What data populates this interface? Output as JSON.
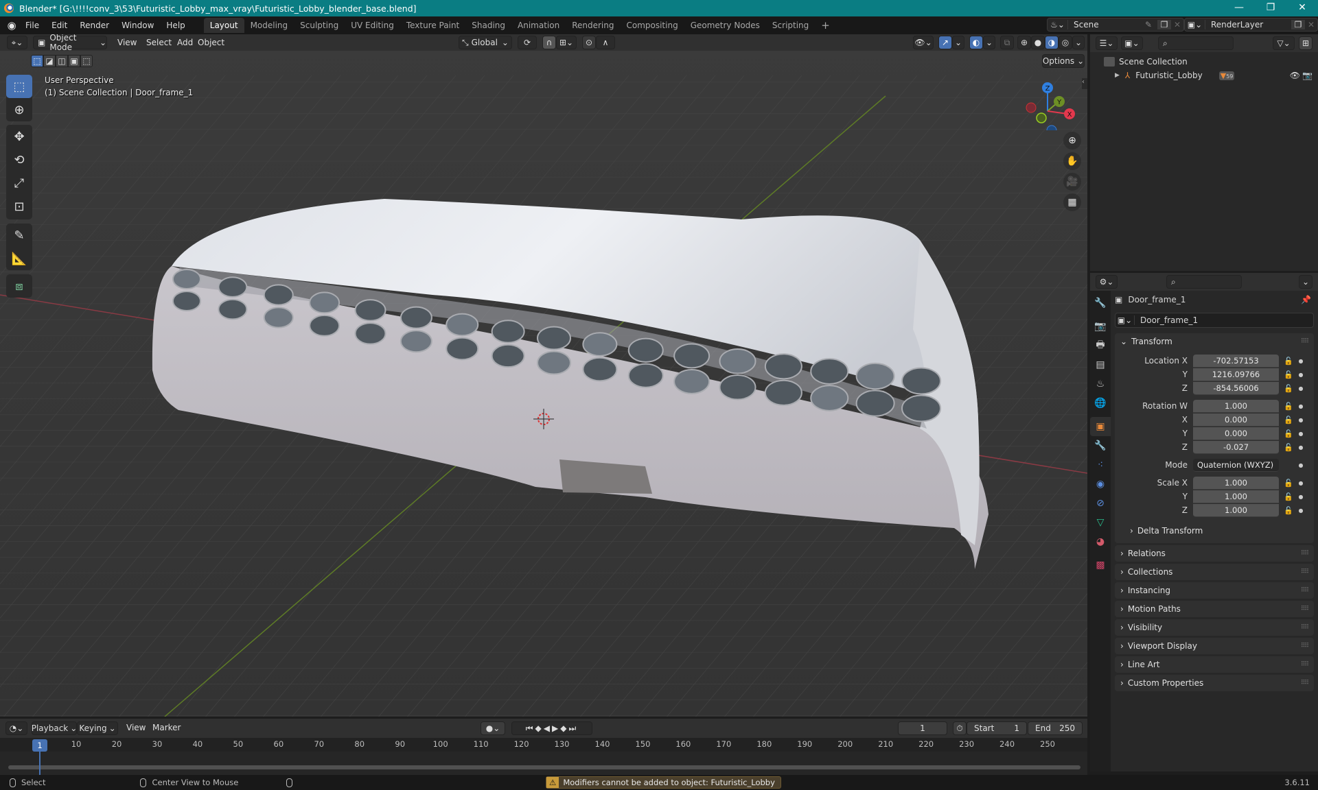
{
  "titlebar": {
    "title": "Blender* [G:\\!!!!conv_3\\53\\Futuristic_Lobby_max_vray\\Futuristic_Lobby_blender_base.blend]",
    "minimize": "—",
    "maximize": "❐",
    "close": "✕"
  },
  "menubar": {
    "menus": [
      "File",
      "Edit",
      "Render",
      "Window",
      "Help"
    ],
    "workspaces": [
      "Layout",
      "Modeling",
      "Sculpting",
      "UV Editing",
      "Texture Paint",
      "Shading",
      "Animation",
      "Rendering",
      "Compositing",
      "Geometry Nodes",
      "Scripting"
    ],
    "active_workspace": "Layout",
    "add_workspace": "+",
    "scene_name": "Scene",
    "view_layer": "RenderLayer"
  },
  "viewport": {
    "mode": "Object Mode",
    "menus": [
      "View",
      "Select",
      "Add",
      "Object"
    ],
    "transform_orientation": "Global",
    "options_label": "Options",
    "view_name": "User Perspective",
    "collection_info": "(1) Scene Collection | Door_frame_1",
    "gizmo_axes": {
      "x": "X",
      "y": "Y",
      "z": "Z"
    },
    "tools": [
      "select-box",
      "cursor",
      "move",
      "rotate",
      "scale",
      "transform",
      "annotate",
      "measure",
      "add-cube"
    ],
    "nav_buttons": [
      "zoom",
      "pan",
      "camera",
      "ortho-grid"
    ]
  },
  "outliner": {
    "search_placeholder": "",
    "root": "Scene Collection",
    "items": [
      {
        "name": "Futuristic_Lobby",
        "badge_count": "59"
      }
    ]
  },
  "properties": {
    "search_placeholder": "",
    "object_name": "Door_frame_1",
    "data_name": "Door_frame_1",
    "transform": {
      "title": "Transform",
      "location": {
        "label": "Location X",
        "x": "-702.57153",
        "y": "1216.09766",
        "z": "-854.56006"
      },
      "rotation": {
        "label": "Rotation W",
        "w": "1.000",
        "x": "0.000",
        "y": "0.000",
        "z": "-0.027"
      },
      "mode_label": "Mode",
      "mode_value": "Quaternion (WXYZ)",
      "scale": {
        "label": "Scale X",
        "x": "1.000",
        "y": "1.000",
        "z": "1.000"
      },
      "axis_labels": {
        "x": "X",
        "y": "Y",
        "z": "Z"
      },
      "delta": "Delta Transform"
    },
    "panels": [
      "Relations",
      "Collections",
      "Instancing",
      "Motion Paths",
      "Visibility",
      "Viewport Display",
      "Line Art",
      "Custom Properties"
    ]
  },
  "timeline": {
    "menus": [
      "Playback",
      "Keying",
      "View",
      "Marker"
    ],
    "current_frame": "1",
    "start_label": "Start",
    "start": "1",
    "end_label": "End",
    "end": "250",
    "ticks": [
      "1",
      "10",
      "20",
      "30",
      "40",
      "50",
      "60",
      "70",
      "80",
      "90",
      "100",
      "110",
      "120",
      "130",
      "140",
      "150",
      "160",
      "170",
      "180",
      "190",
      "200",
      "210",
      "220",
      "230",
      "240",
      "250"
    ]
  },
  "statusbar": {
    "left_action": "Select",
    "middle_action": "Center View to Mouse",
    "warning": "Modifiers cannot be added to object: Futuristic_Lobby",
    "version": "3.6.11"
  },
  "colors": {
    "titlebar": "#0a7d83",
    "accent_blue": "#4772b3",
    "object_orange": "#e8893a",
    "axis_x": "#e3384d",
    "axis_y": "#7ca02a",
    "axis_z": "#2f7fe0"
  }
}
